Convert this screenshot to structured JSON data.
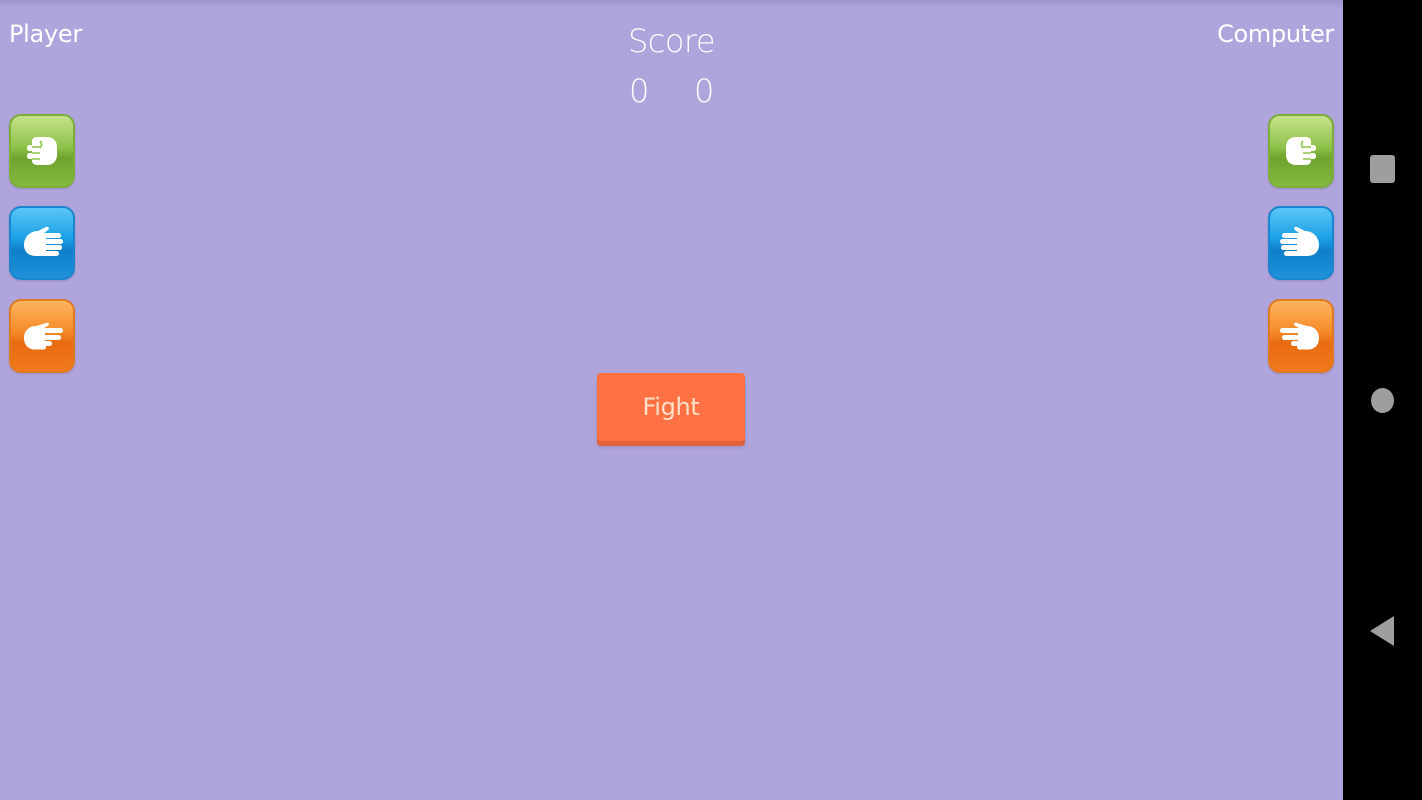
{
  "labels": {
    "player": "Player",
    "computer": "Computer"
  },
  "score": {
    "title": "Score",
    "player": "0",
    "computer": "0"
  },
  "choices": [
    {
      "name": "rock",
      "icon": "fist-icon",
      "color": "#8fc24a"
    },
    {
      "name": "paper",
      "icon": "open-hand-icon",
      "color": "#1a9ee6"
    },
    {
      "name": "scissors",
      "icon": "scissors-hand-icon",
      "color": "#f58a26"
    }
  ],
  "fight_button": {
    "label": "Fight",
    "color": "#ff7043"
  },
  "theme": {
    "background": "#b0a4dc"
  },
  "navbar": {
    "recents": "recents-icon",
    "home": "home-icon",
    "back": "back-icon"
  }
}
